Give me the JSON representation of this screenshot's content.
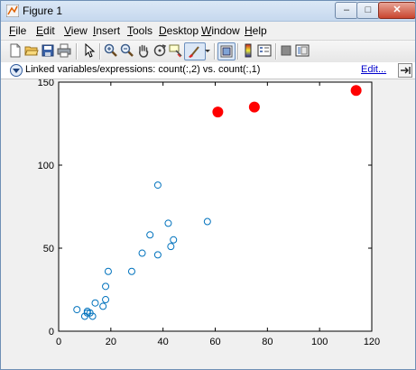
{
  "window": {
    "title": "Figure 1",
    "controls": {
      "minimize": "–",
      "maximize": "□",
      "close": "✕"
    }
  },
  "menubar": {
    "items": [
      {
        "label_u": "F",
        "label_rest": "ile"
      },
      {
        "label_u": "E",
        "label_rest": "dit"
      },
      {
        "label_u": "V",
        "label_rest": "iew"
      },
      {
        "label_u": "I",
        "label_rest": "nsert"
      },
      {
        "label_u": "T",
        "label_rest": "ools"
      },
      {
        "label_u": "D",
        "label_rest": "esktop"
      },
      {
        "label_u": "W",
        "label_rest": "indow"
      },
      {
        "label_u": "H",
        "label_rest": "elp"
      }
    ]
  },
  "toolbar": {
    "icons": [
      "new-figure-icon",
      "open-file-icon",
      "save-icon",
      "print-icon",
      "pointer-icon",
      "zoom-in-icon",
      "zoom-out-icon",
      "pan-hand-icon",
      "rotate-3d-icon",
      "data-cursor-icon",
      "brush-icon",
      "brush-dropdown-icon",
      "link-plot-icon",
      "colorbar-icon",
      "legend-icon",
      "hide-plot-tools-icon",
      "show-plot-tools-icon"
    ]
  },
  "linkbar": {
    "text": "Linked variables/expressions: count(:,2) vs. count(:,1)",
    "edit_label": "Edit..."
  },
  "chart_data": {
    "type": "scatter",
    "xlim": [
      0,
      120
    ],
    "ylim": [
      0,
      150
    ],
    "xticks": [
      "0",
      "20",
      "40",
      "60",
      "80",
      "100",
      "120"
    ],
    "yticks": [
      "0",
      "50",
      "100",
      "150"
    ],
    "grid": false,
    "series": [
      {
        "marker": "open-circle",
        "color": "#0072bd",
        "points": [
          [
            7,
            13
          ],
          [
            10,
            9
          ],
          [
            11,
            11
          ],
          [
            11,
            12
          ],
          [
            12,
            11
          ],
          [
            13,
            9
          ],
          [
            14,
            17
          ],
          [
            17,
            15
          ],
          [
            18,
            19
          ],
          [
            18,
            27
          ],
          [
            19,
            36
          ],
          [
            28,
            36
          ],
          [
            32,
            47
          ],
          [
            35,
            58
          ],
          [
            38,
            46
          ],
          [
            38,
            88
          ],
          [
            42,
            65
          ],
          [
            43,
            51
          ],
          [
            44,
            55
          ],
          [
            57,
            66
          ]
        ]
      },
      {
        "marker": "filled-circle",
        "color": "#ff0000",
        "points": [
          [
            61,
            132
          ],
          [
            75,
            135
          ],
          [
            114,
            145
          ]
        ]
      }
    ]
  }
}
